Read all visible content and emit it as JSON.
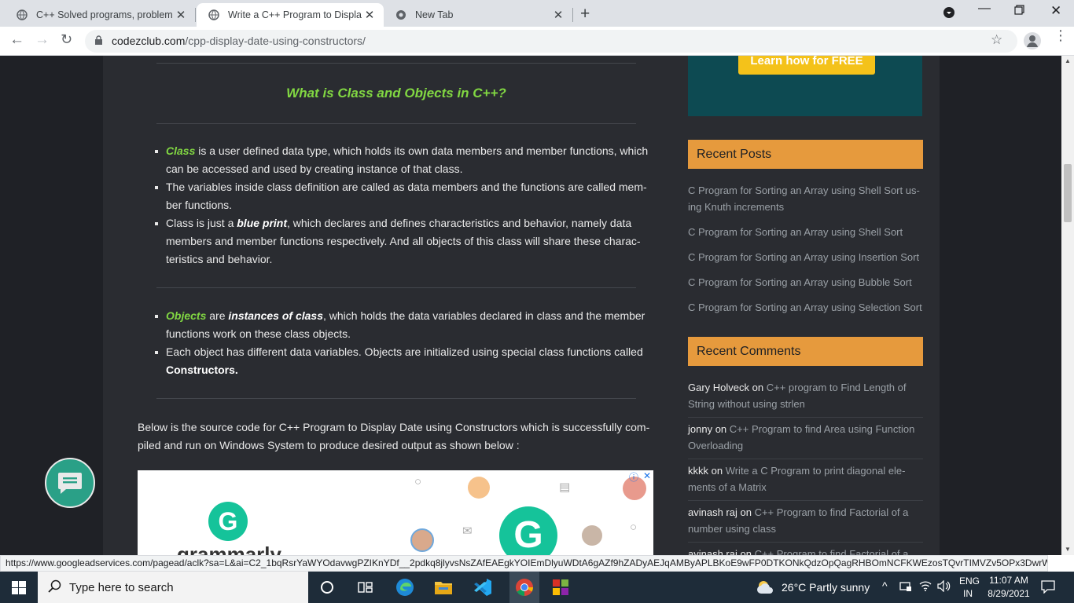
{
  "browser": {
    "tabs": [
      {
        "title": "C++ Solved programs, problems"
      },
      {
        "title": "Write a C++ Program to Display"
      },
      {
        "title": "New Tab"
      }
    ],
    "url_domain": "codezclub.com",
    "url_path": "/cpp-display-date-using-constructors/",
    "status_url": "https://www.googleadservices.com/pagead/aclk?sa=L&ai=C2_1bqRsrYaWYOdavwgPZIKnYDf__2pdkq8jlyvsNsZAfEAEgkYOIEmDlyuWDtA6gAZf9hZADyAEJqAMByAPLBKoE9wFP0DTKONkQdzOpQagRHBOmNCFKWEzosTQvrTIMVZv5OPx3DwrWikHZpu..."
  },
  "article": {
    "heading": "What is Class and Objects in C++?",
    "class_list": [
      {
        "lead": "Class",
        "text": " is a user defined data type, which holds its own data members and member functions, which can be accessed and used by creating instance of that class."
      },
      {
        "text": "The variables inside class definition are called as data members and the functions are called mem­ber functions."
      },
      {
        "pre": "Class is just a ",
        "bold": "blue print",
        "text": ", which declares and defines characteristics and behavior, namely data members and member functions respectively. And all objects of this class will share these charac­teristics and behavior."
      }
    ],
    "object_list": [
      {
        "lead": "Objects",
        "mid": " are ",
        "bold": "instances of class",
        "text": ", which holds the data variables declared in class and the member functions work on these class objects."
      },
      {
        "text": "Each object has different data variables. Objects are initialized using special class functions called ",
        "bold2": "Constructors."
      }
    ],
    "paragraph": "Below is the source code for C++ Program to Display Date using Constructors which is successfully com­piled and run on Windows System to produce desired output as shown below :",
    "ad_brand": "grammarly"
  },
  "sidebar": {
    "banner_cta": "Learn how for FREE",
    "recent_posts_title": "Recent Posts",
    "recent_posts": [
      "C Program for Sorting an Array using Shell Sort us­ing Knuth increments",
      "C Program for Sorting an Array using Shell Sort",
      "C Program for Sorting an Array using Insertion Sort",
      "C Program for Sorting an Array using Bubble Sort",
      "C Program for Sorting an Array using Selection Sort"
    ],
    "recent_comments_title": "Recent Comments",
    "recent_comments": [
      {
        "author": "Gary Holveck",
        "on": " on ",
        "post": "C++ program to Find Length of String without using strlen"
      },
      {
        "author": "jonny",
        "on": " on ",
        "post": "C++ Program to find Area using Function Overloading"
      },
      {
        "author": "kkkk",
        "on": " on ",
        "post": "Write a C Program to print diagonal ele­ments of a Matrix"
      },
      {
        "author": "avinash raj",
        "on": " on ",
        "post": "C++ Program to find Factorial of a number using class"
      },
      {
        "author": "avinash raj",
        "on": " on ",
        "post": "C++ Program to find Factorial of a"
      }
    ]
  },
  "taskbar": {
    "search_placeholder": "Type here to search",
    "weather": "26°C  Partly sunny",
    "lang1": "ENG",
    "lang2": "IN",
    "time": "11:07 AM",
    "date": "8/29/2021"
  },
  "colors": {
    "accent_green": "#81d742",
    "widget_orange": "#e69a3d",
    "page_bg": "#2a2c31"
  }
}
